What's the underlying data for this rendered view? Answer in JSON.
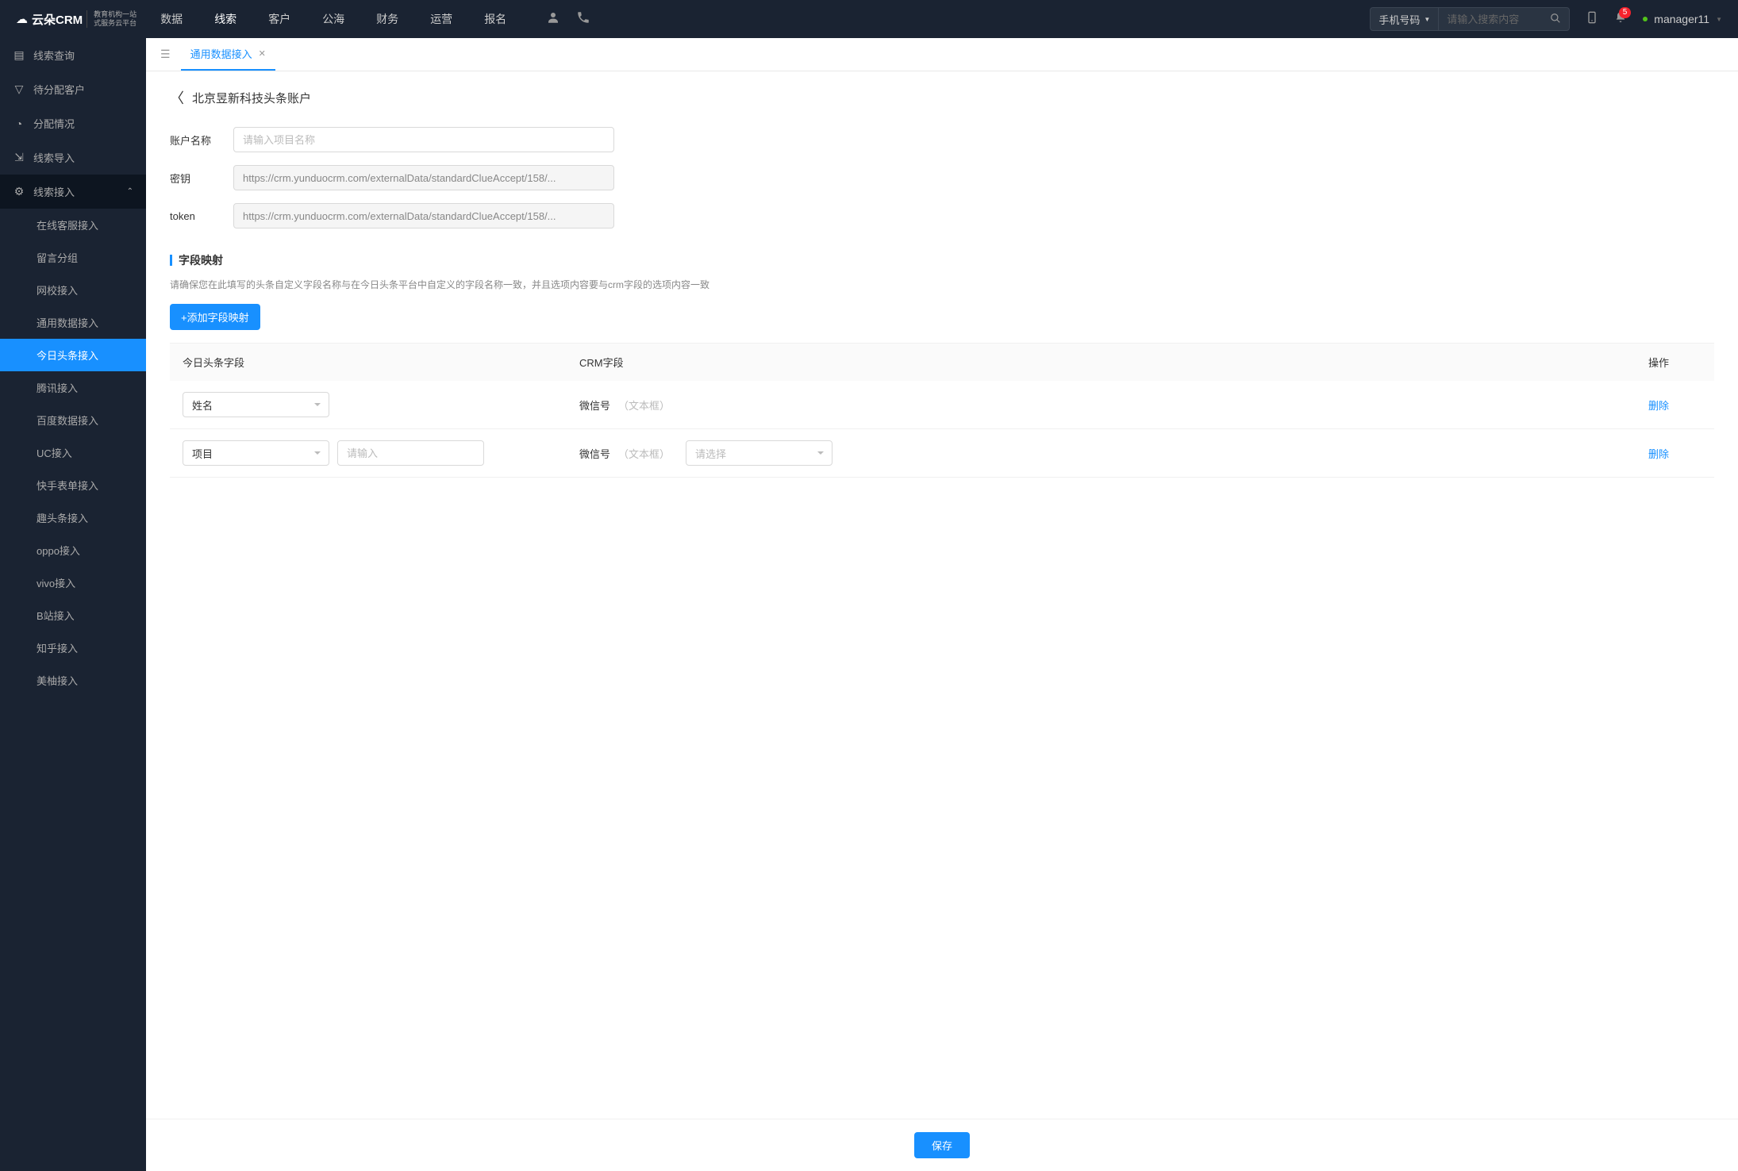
{
  "header": {
    "logo": {
      "main": "云朵CRM",
      "sub1": "教育机构一站",
      "sub2": "式服务云平台"
    },
    "nav": [
      "数据",
      "线索",
      "客户",
      "公海",
      "财务",
      "运营",
      "报名"
    ],
    "nav_active": 1,
    "search_select": "手机号码",
    "search_placeholder": "请输入搜索内容",
    "badge": "5",
    "user": "manager11"
  },
  "sidebar": {
    "items": [
      {
        "icon": "▤",
        "label": "线索查询"
      },
      {
        "icon": "▽",
        "label": "待分配客户"
      },
      {
        "icon": "◔",
        "label": "分配情况"
      },
      {
        "icon": "⇲",
        "label": "线索导入"
      },
      {
        "icon": "⚙",
        "label": "线索接入",
        "expanded": true,
        "children": [
          "在线客服接入",
          "留言分组",
          "网校接入",
          "通用数据接入",
          "今日头条接入",
          "腾讯接入",
          "百度数据接入",
          "UC接入",
          "快手表单接入",
          "趣头条接入",
          "oppo接入",
          "vivo接入",
          "B站接入",
          "知乎接入",
          "美柚接入"
        ],
        "active_child": 4
      }
    ]
  },
  "tab": {
    "label": "通用数据接入"
  },
  "page": {
    "breadcrumb_title": "北京昱新科技头条账户",
    "form": {
      "account_label": "账户名称",
      "account_placeholder": "请输入项目名称",
      "secret_label": "密钥",
      "secret_value": "https://crm.yunduocrm.com/externalData/standardClueAccept/158/...",
      "token_label": "token",
      "token_value": "https://crm.yunduocrm.com/externalData/standardClueAccept/158/..."
    },
    "section_title": "字段映射",
    "section_desc": "请确保您在此填写的头条自定义字段名称与在今日头条平台中自定义的字段名称一致，并且选项内容要与crm字段的选项内容一致",
    "add_button": "+添加字段映射",
    "table": {
      "headers": [
        "今日头条字段",
        "CRM字段",
        "操作"
      ],
      "rows": [
        {
          "toutiao_select": "姓名",
          "crm_label": "微信号",
          "crm_hint": "（文本框）",
          "action": "删除"
        },
        {
          "toutiao_select": "项目",
          "toutiao_input_placeholder": "请输入",
          "crm_label": "微信号",
          "crm_hint": "（文本框）",
          "crm_select_placeholder": "请选择",
          "action": "删除"
        }
      ]
    },
    "save_button": "保存"
  }
}
